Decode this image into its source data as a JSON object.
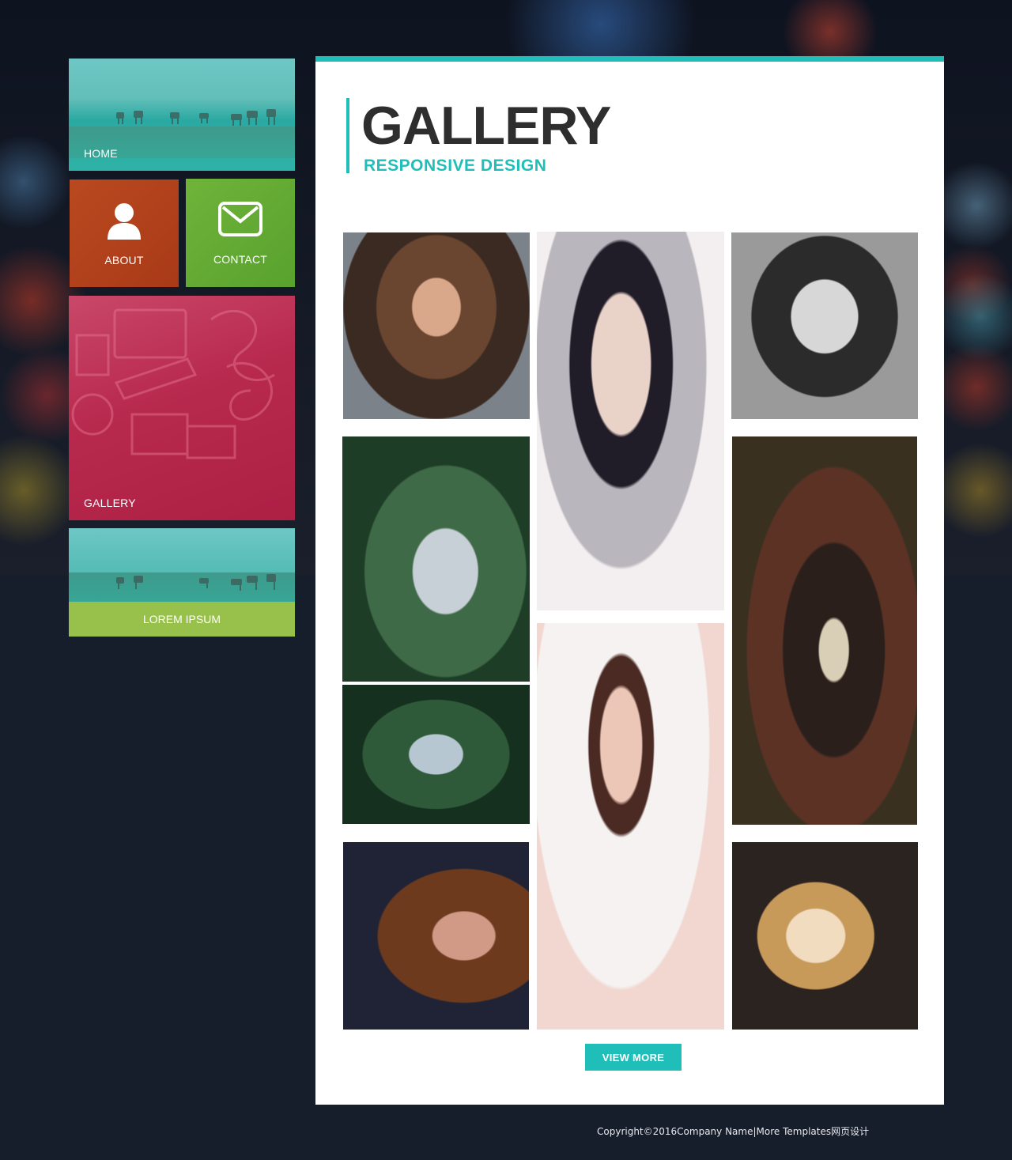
{
  "colors": {
    "accent": "#20beb8",
    "home_tile": "#35b0a8",
    "about_tile": "#b0401b",
    "contact_tile": "#62aa33",
    "gallery_tile": "#b5264c",
    "lorem_bar": "#98c14b",
    "page_bg": "#161d2b"
  },
  "sidebar": {
    "home_label": "HOME",
    "about_label": "ABOUT",
    "about_icon": "user-icon",
    "contact_label": "CONTACT",
    "contact_icon": "mail-icon",
    "gallery_label": "GALLERY",
    "lorem_label": "LOREM IPSUM"
  },
  "main": {
    "title": "GALLERY",
    "subtitle": "RESPONSIVE DESIGN",
    "view_more_label": "VIEW MORE"
  },
  "footer": {
    "copyright": "Copyright©2016Company Name|More Templates网页设计"
  }
}
